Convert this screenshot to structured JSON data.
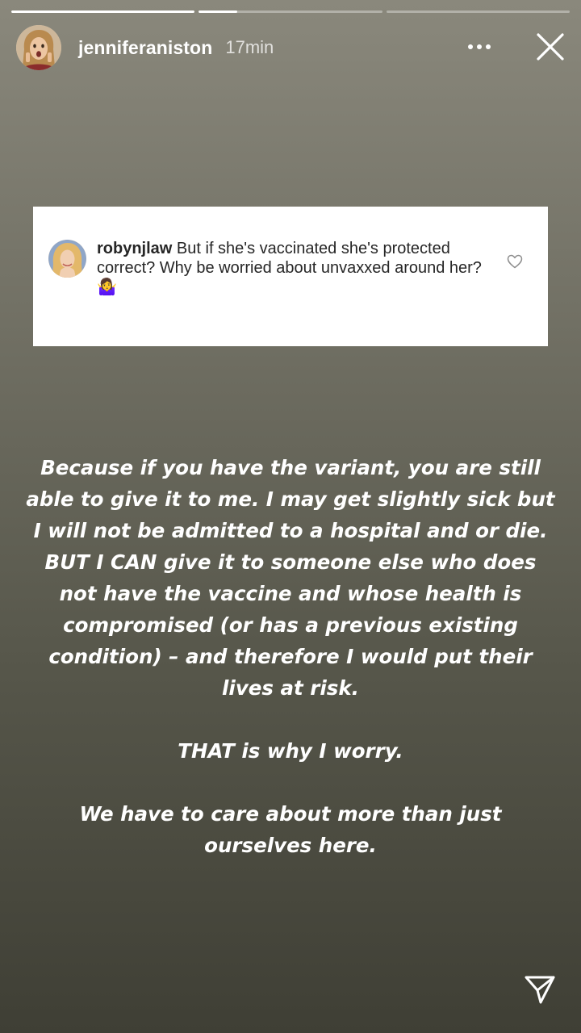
{
  "story": {
    "segments": [
      {
        "progress": 1.0
      },
      {
        "progress": 0.21
      },
      {
        "progress": 0.0
      }
    ]
  },
  "header": {
    "username": "jenniferaniston",
    "timestamp": "17min",
    "more_icon": "more-dots-icon",
    "close_icon": "close-icon"
  },
  "comment": {
    "username": "robynjlaw",
    "text": "But if she's vaccinated she's protected correct? Why be worried about unvaxxed around her?",
    "emoji": "🤷‍♀️",
    "heart_icon": "heart-outline-icon"
  },
  "reply": {
    "paragraphs": [
      "Because if you have the variant, you are still able to give it to me. I may get slightly sick but I will not be admitted to a hospital and or die. BUT I CAN give it to someone else who does not have the vaccine and whose health is compromised (or has a previous existing condition) – and therefore I would put their lives at risk.",
      "THAT is why I worry.",
      "We have to care about more than just ourselves here."
    ]
  },
  "footer": {
    "send_icon": "send-icon"
  }
}
